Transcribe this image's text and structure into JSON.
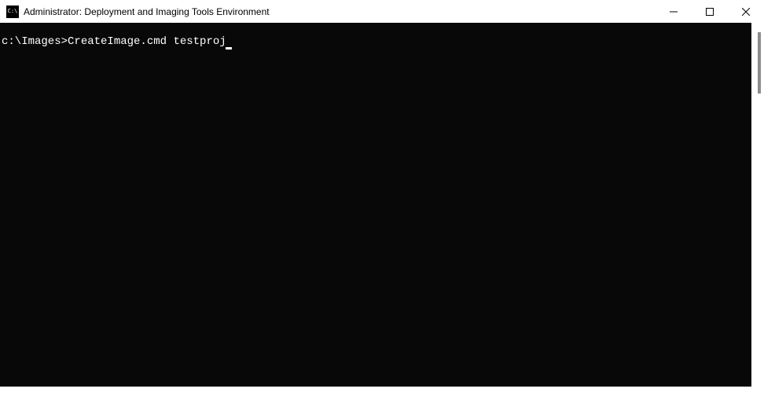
{
  "window": {
    "title": "Administrator: Deployment and Imaging Tools Environment",
    "icon_text": "C:\\"
  },
  "terminal": {
    "prompt": "c:\\Images>",
    "command": "CreateImage.cmd testproj"
  }
}
